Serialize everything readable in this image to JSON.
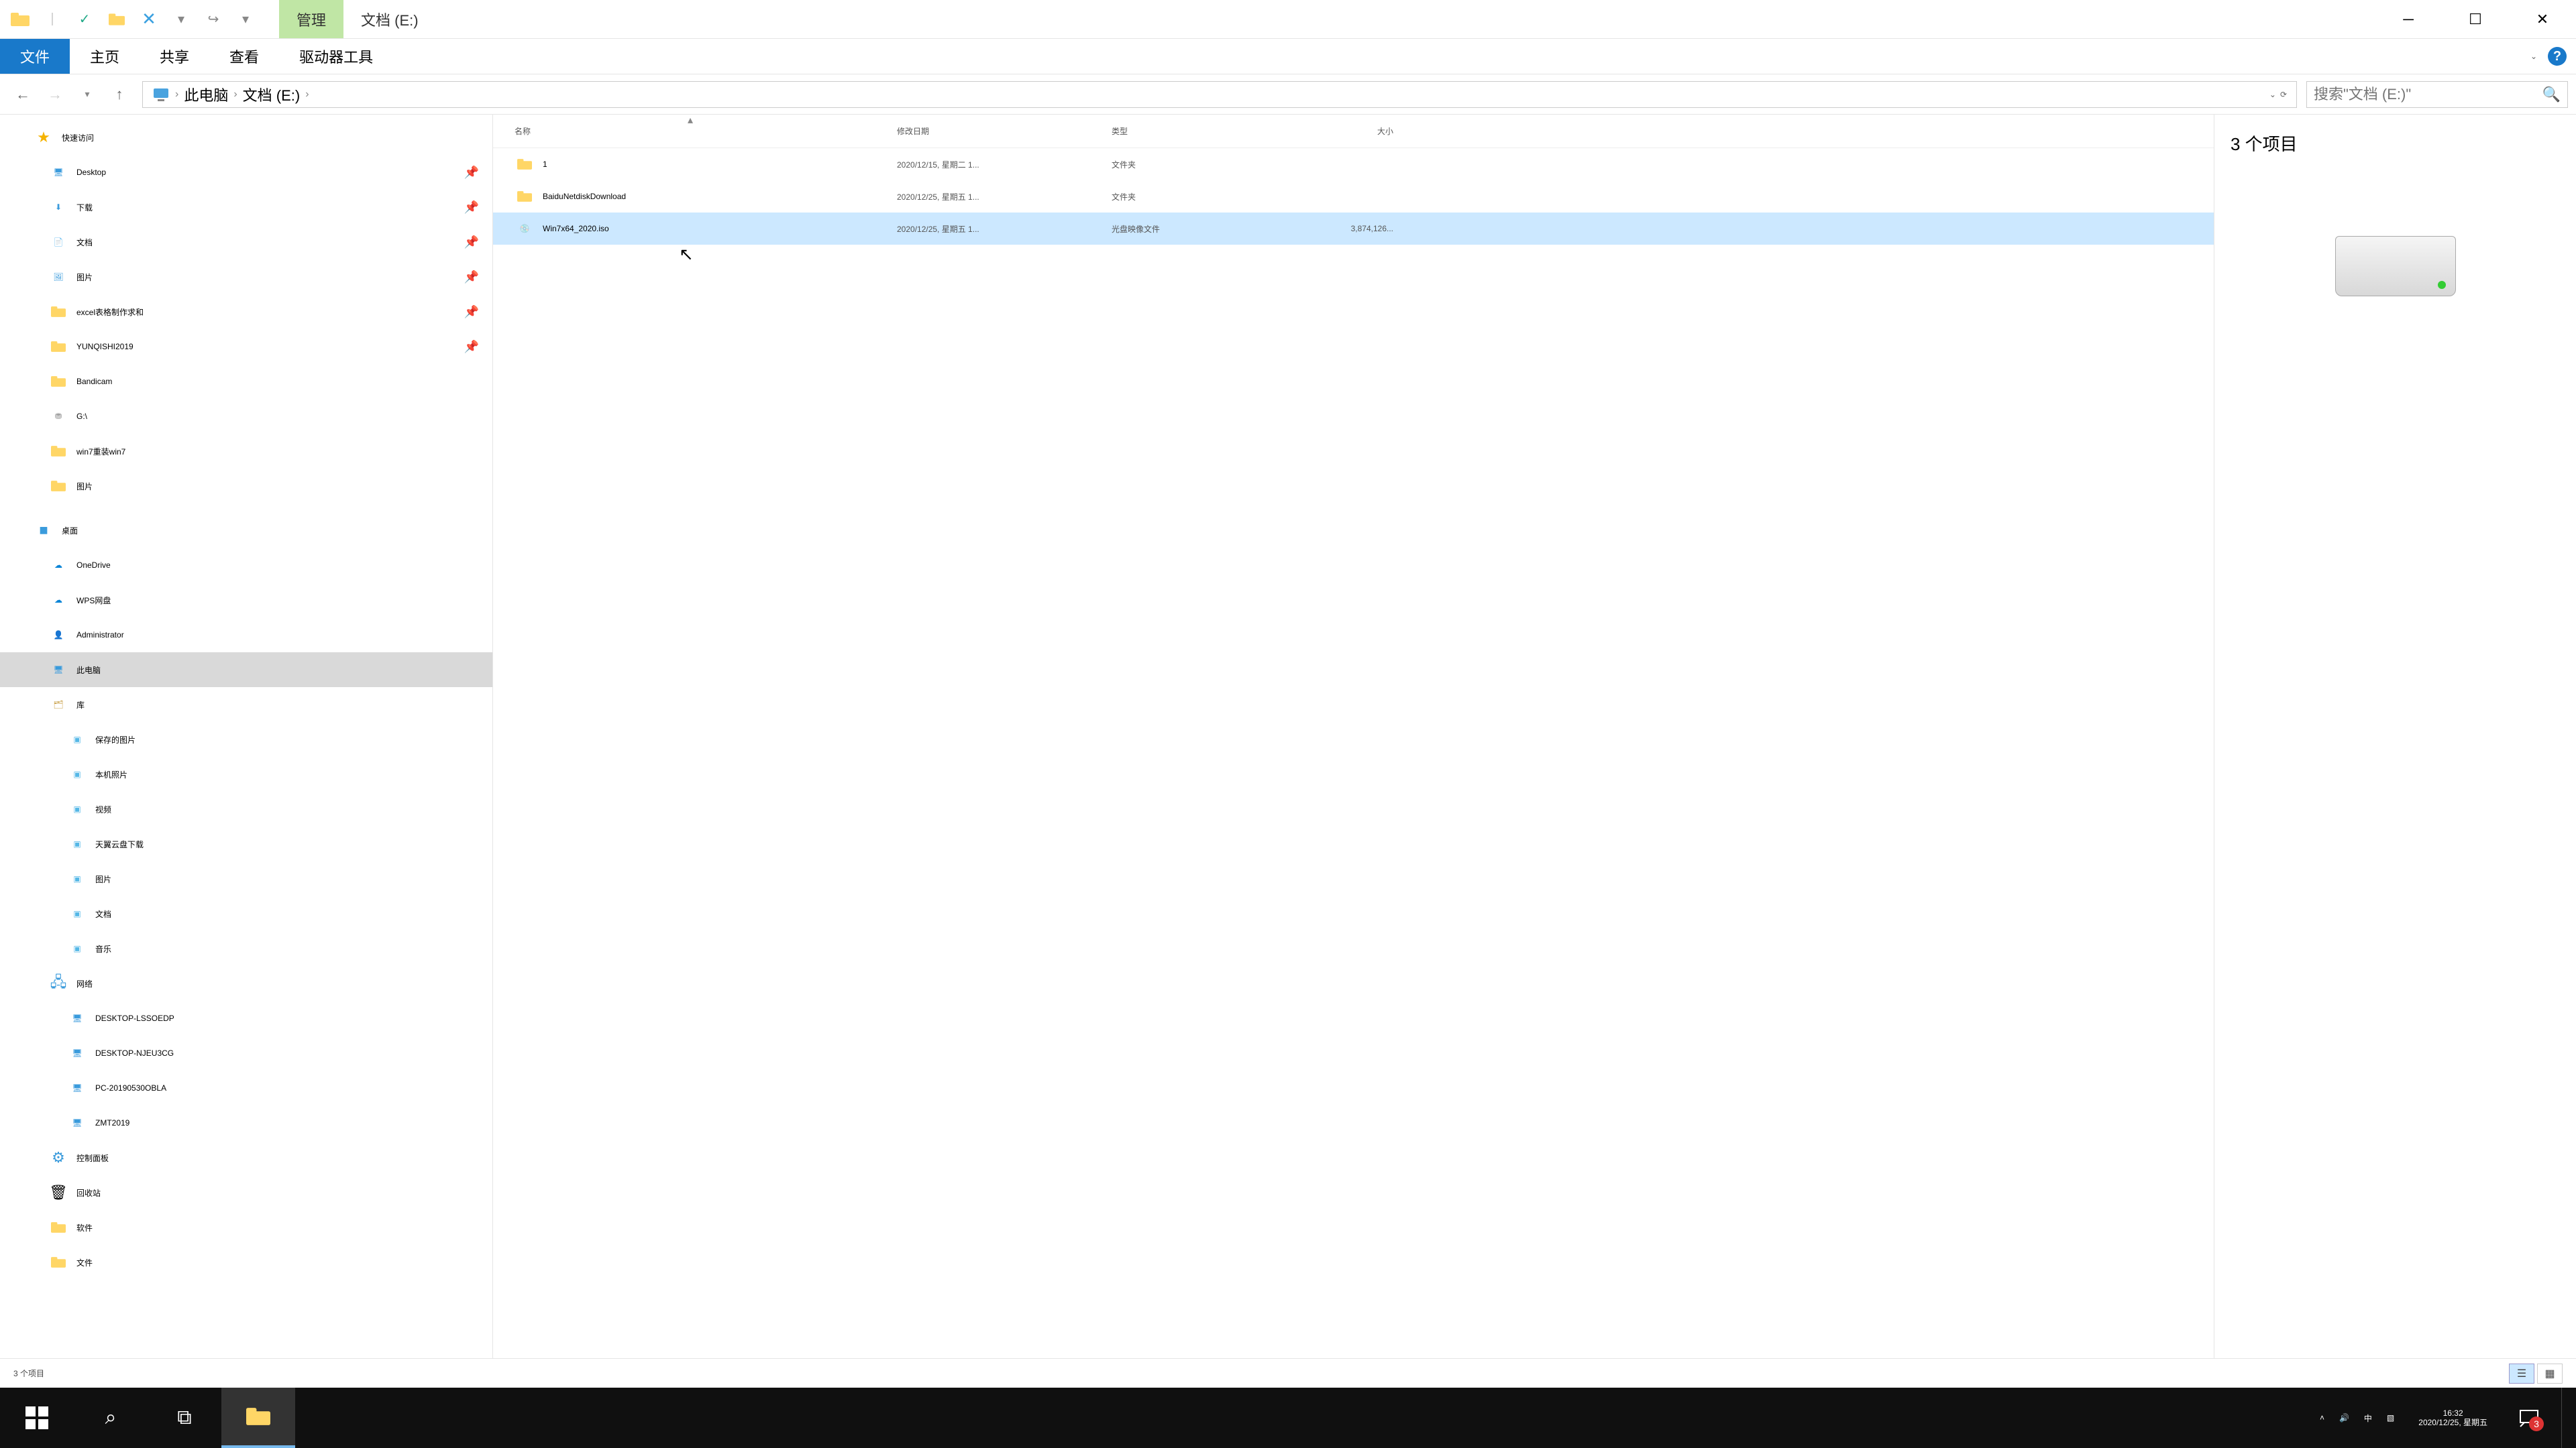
{
  "titlebar": {
    "contextual_tab": "管理",
    "window_title": "文档 (E:)"
  },
  "ribbon": {
    "file": "文件",
    "tabs": [
      "主页",
      "共享",
      "查看",
      "驱动器工具"
    ],
    "expand_hint": "⌄"
  },
  "navbar": {
    "crumbs": [
      "此电脑",
      "文档 (E:)"
    ],
    "search_placeholder": "搜索\"文档 (E:)\""
  },
  "tree": {
    "quick_access": "快速访问",
    "quick_items": [
      {
        "label": "Desktop",
        "icon": "desktop",
        "pinned": true
      },
      {
        "label": "下载",
        "icon": "downloads",
        "pinned": true
      },
      {
        "label": "文档",
        "icon": "documents",
        "pinned": true
      },
      {
        "label": "图片",
        "icon": "pictures",
        "pinned": true
      },
      {
        "label": "excel表格制作求和",
        "icon": "folder",
        "pinned": true
      },
      {
        "label": "YUNQISHI2019",
        "icon": "folder",
        "pinned": true
      },
      {
        "label": "Bandicam",
        "icon": "folder",
        "pinned": false
      },
      {
        "label": "G:\\",
        "icon": "drive",
        "pinned": false
      },
      {
        "label": "win7重装win7",
        "icon": "folder",
        "pinned": false
      },
      {
        "label": "图片",
        "icon": "folder",
        "pinned": false
      }
    ],
    "desktop": "桌面",
    "desktop_items": [
      {
        "label": "OneDrive",
        "icon": "onedrive"
      },
      {
        "label": "WPS网盘",
        "icon": "wps"
      },
      {
        "label": "Administrator",
        "icon": "user"
      },
      {
        "label": "此电脑",
        "icon": "thispc",
        "selected": true
      },
      {
        "label": "库",
        "icon": "libraries"
      }
    ],
    "library_items": [
      {
        "label": "保存的图片"
      },
      {
        "label": "本机照片"
      },
      {
        "label": "视频"
      },
      {
        "label": "天翼云盘下载"
      },
      {
        "label": "图片"
      },
      {
        "label": "文档"
      },
      {
        "label": "音乐"
      }
    ],
    "network": "网络",
    "network_items": [
      {
        "label": "DESKTOP-LSSOEDP"
      },
      {
        "label": "DESKTOP-NJEU3CG"
      },
      {
        "label": "PC-20190530OBLA"
      },
      {
        "label": "ZMT2019"
      }
    ],
    "control_panel": "控制面板",
    "recycle": "回收站",
    "software": "软件",
    "documents": "文件"
  },
  "columns": {
    "name": "名称",
    "date": "修改日期",
    "type": "类型",
    "size": "大小"
  },
  "files": [
    {
      "name": "1",
      "date": "2020/12/15, 星期二 1...",
      "type": "文件夹",
      "size": "",
      "icon": "folder",
      "selected": false
    },
    {
      "name": "BaiduNetdiskDownload",
      "date": "2020/12/25, 星期五 1...",
      "type": "文件夹",
      "size": "",
      "icon": "folder",
      "selected": false
    },
    {
      "name": "Win7x64_2020.iso",
      "date": "2020/12/25, 星期五 1...",
      "type": "光盘映像文件",
      "size": "3,874,126...",
      "icon": "iso",
      "selected": true
    }
  ],
  "preview": {
    "count_label": "3 个项目"
  },
  "statusbar": {
    "count": "3 个项目"
  },
  "taskbar": {
    "ime": "中",
    "time": "16:32",
    "date": "2020/12/25, 星期五",
    "notif_count": "3"
  }
}
